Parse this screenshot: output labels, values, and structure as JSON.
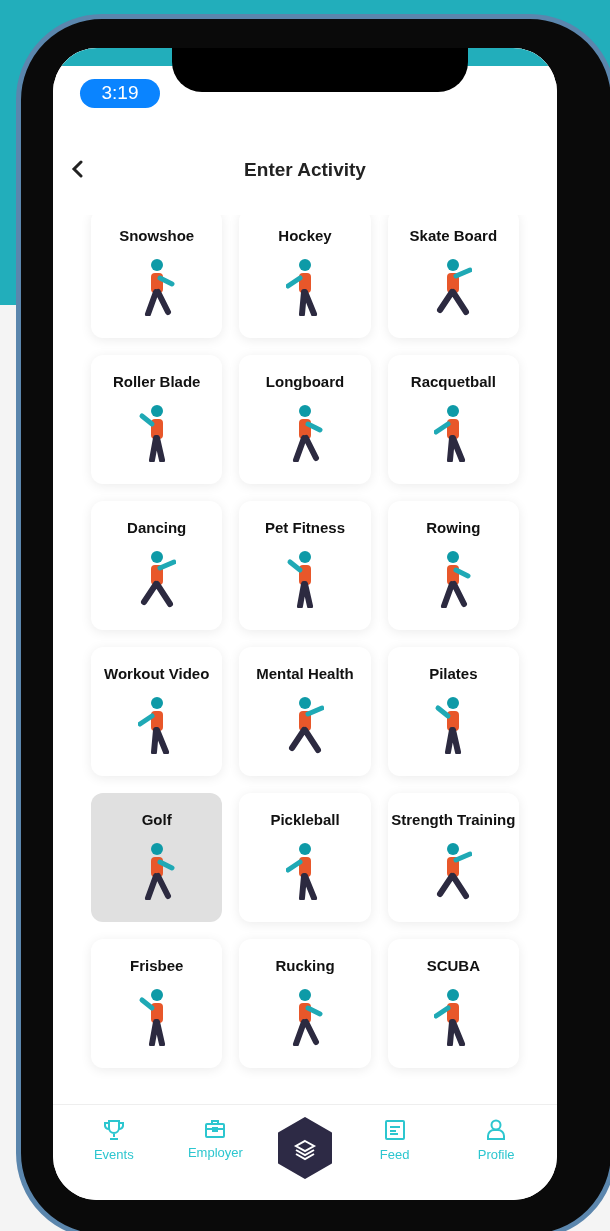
{
  "status_bar": {
    "time": "3:19"
  },
  "header": {
    "title": "Enter Activity"
  },
  "activities": [
    {
      "label": "Snowshoe",
      "selected": false
    },
    {
      "label": "Hockey",
      "selected": false
    },
    {
      "label": "Skate Board",
      "selected": false
    },
    {
      "label": "Roller Blade",
      "selected": false
    },
    {
      "label": "Longboard",
      "selected": false
    },
    {
      "label": "Racquetball",
      "selected": false
    },
    {
      "label": "Dancing",
      "selected": false
    },
    {
      "label": "Pet Fitness",
      "selected": false
    },
    {
      "label": "Rowing",
      "selected": false
    },
    {
      "label": "Workout Video",
      "selected": false
    },
    {
      "label": "Mental Health",
      "selected": false
    },
    {
      "label": "Pilates",
      "selected": false
    },
    {
      "label": "Golf",
      "selected": true
    },
    {
      "label": "Pickleball",
      "selected": false
    },
    {
      "label": "Strength Training",
      "selected": false
    },
    {
      "label": "Frisbee",
      "selected": false
    },
    {
      "label": "Rucking",
      "selected": false
    },
    {
      "label": "SCUBA",
      "selected": false
    }
  ],
  "bottom_nav": [
    {
      "label": "Events",
      "kind": "trophy"
    },
    {
      "label": "Employer",
      "kind": "briefcase"
    },
    {
      "kind": "center"
    },
    {
      "label": "Feed",
      "kind": "feed"
    },
    {
      "label": "Profile",
      "kind": "person"
    }
  ]
}
